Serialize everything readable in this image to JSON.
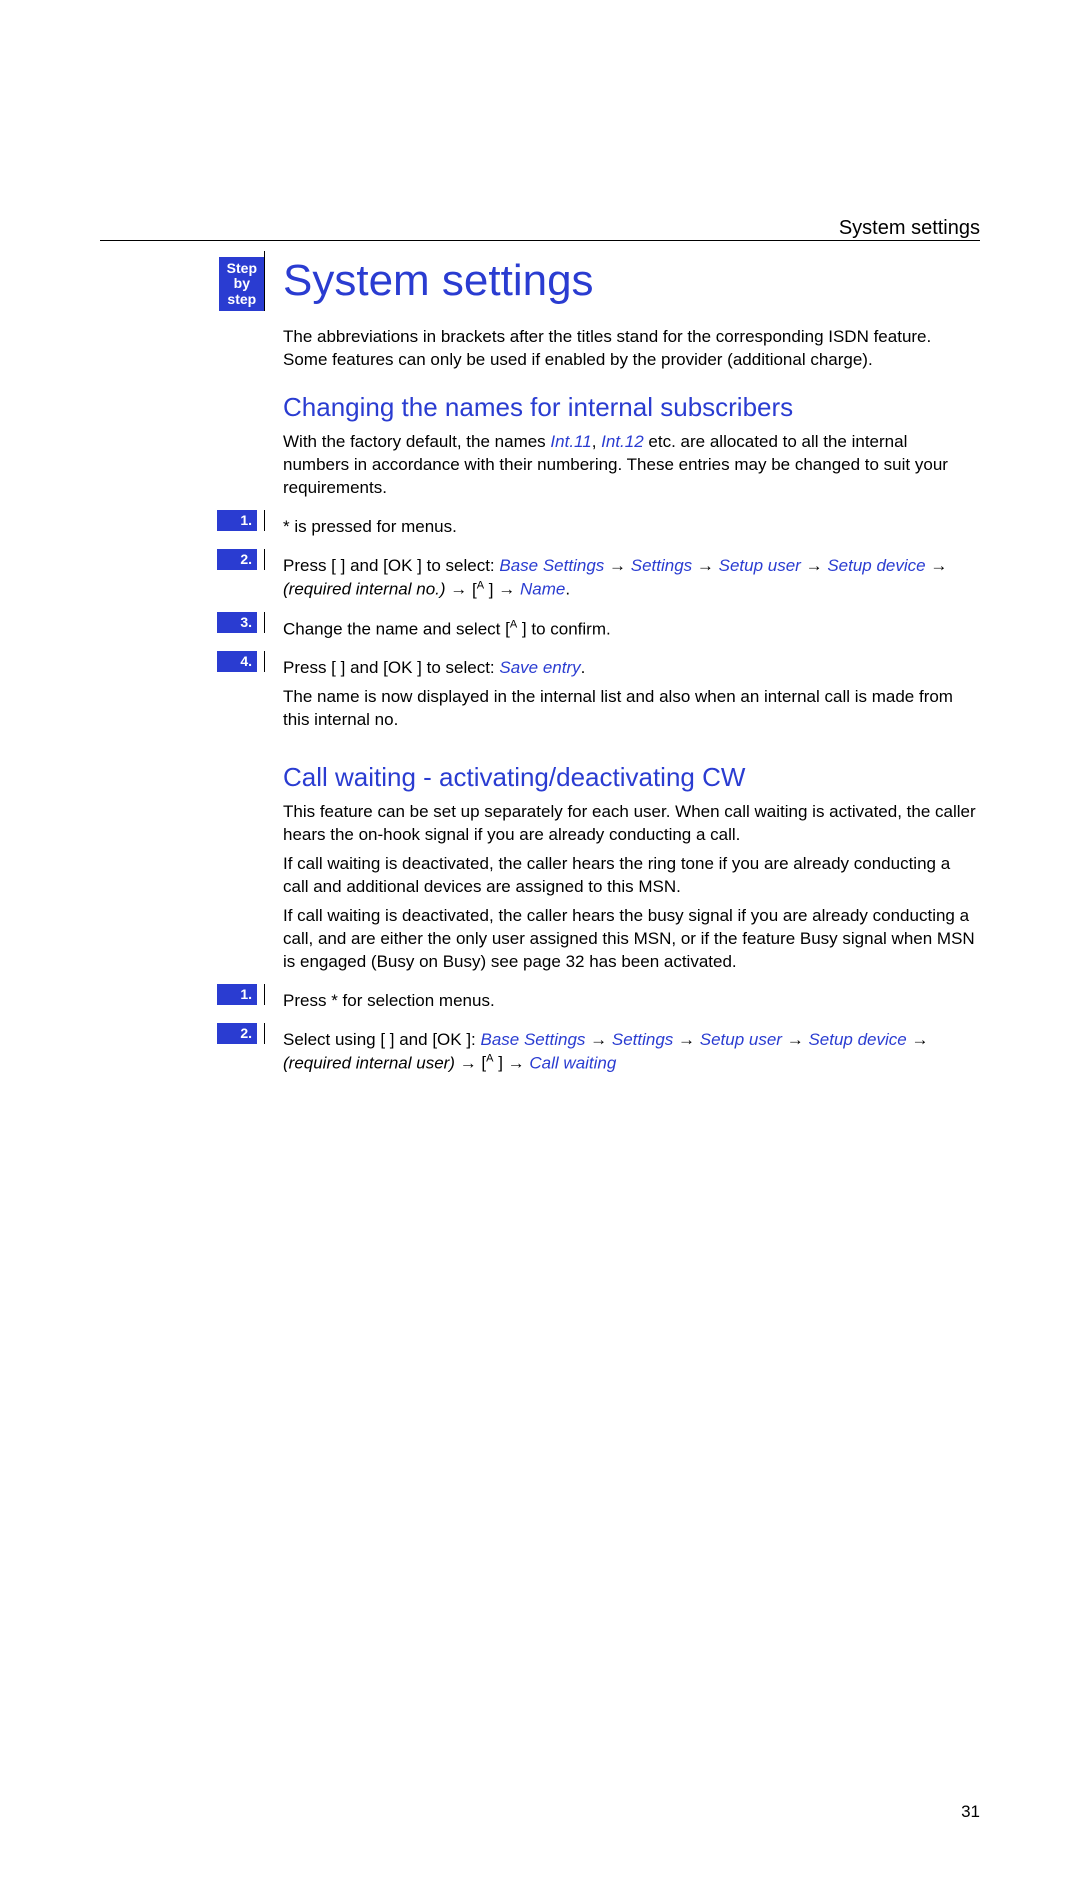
{
  "header_right": "System settings",
  "step_box_lines": [
    "Step",
    "by",
    "step"
  ],
  "title": "System settings",
  "intro": "The abbreviations in brackets after the titles stand for the corresponding ISDN feature. Some features can only be used if enabled by the provider (additional charge).",
  "sec1": {
    "heading": "Changing the names for internal subscribers",
    "p_pre": "With the factory default, the names ",
    "int11": "Int.11",
    "sep": ", ",
    "int12": "Int.12",
    "p_post": " etc. are allocated to all the internal numbers in accordance with their numbering. These entries may be changed to suit your requirements.",
    "steps": [
      {
        "num": "1.",
        "pre": "",
        "plain1": "",
        "star": "*",
        "plain2": "    is pressed for menus."
      },
      {
        "num": "2.",
        "pre": "Press [  ] and [OK ] to select: ",
        "chain": [
          {
            "t": "link",
            "v": "Base Settings"
          },
          {
            "t": "arrow"
          },
          {
            "t": "link",
            "v": "Settings"
          },
          {
            "t": "arrow"
          },
          {
            "t": "link",
            "v": "Setup user"
          },
          {
            "t": "arrow"
          },
          {
            "t": "link",
            "v": "Setup device"
          },
          {
            "t": "arrow"
          },
          {
            "t": "italic",
            "v": "(required internal no.)"
          },
          {
            "t": "arrow"
          },
          {
            "t": "caret"
          },
          {
            "t": "arrow"
          },
          {
            "t": "link",
            "v": "Name"
          },
          {
            "t": "plain",
            "v": "."
          }
        ]
      },
      {
        "num": "3.",
        "pre": "Change the name and select ",
        "chain": [
          {
            "t": "caret"
          },
          {
            "t": "plain",
            "v": " to confirm."
          }
        ]
      },
      {
        "num": "4.",
        "pre": "Press [   ] and [OK ] to select: ",
        "chain": [
          {
            "t": "link",
            "v": "Save entry"
          },
          {
            "t": "plain",
            "v": "."
          }
        ],
        "tail": "The name is now displayed in the internal list and also when an internal call is made from this internal no."
      }
    ]
  },
  "sec2": {
    "heading": "Call waiting - activating/deactivating CW",
    "p1": "This feature can be set up separately for each user. When call waiting is activated, the caller hears the on-hook signal if you are already conducting a call.",
    "p2": "If call waiting is deactivated, the caller hears the ring tone if you are already conducting a call and additional devices are assigned to this MSN.",
    "p3": "If call waiting is deactivated, the caller hears the busy signal if you are already conducting a call, and are either the only user assigned this MSN, or if the feature Busy signal when MSN is engaged (Busy on Busy) see page 32 has been activated.",
    "steps": [
      {
        "num": "1.",
        "pre": "Press ",
        "star": "*",
        "post": "    for selection menus."
      },
      {
        "num": "2.",
        "pre": "Select using [  ] and [OK ]: ",
        "chain": [
          {
            "t": "link",
            "v": "Base Settings"
          },
          {
            "t": "arrow"
          },
          {
            "t": "link",
            "v": "Settings"
          },
          {
            "t": "arrow"
          },
          {
            "t": "link",
            "v": "Setup user"
          },
          {
            "t": "arrow"
          },
          {
            "t": "link",
            "v": "Setup device"
          },
          {
            "t": "arrow"
          },
          {
            "t": "italic",
            "v": "(required internal user)"
          },
          {
            "t": "arrow"
          },
          {
            "t": "caret"
          },
          {
            "t": "arrow"
          },
          {
            "t": "link",
            "v": "Call waiting"
          }
        ]
      }
    ]
  },
  "page_number": "31"
}
